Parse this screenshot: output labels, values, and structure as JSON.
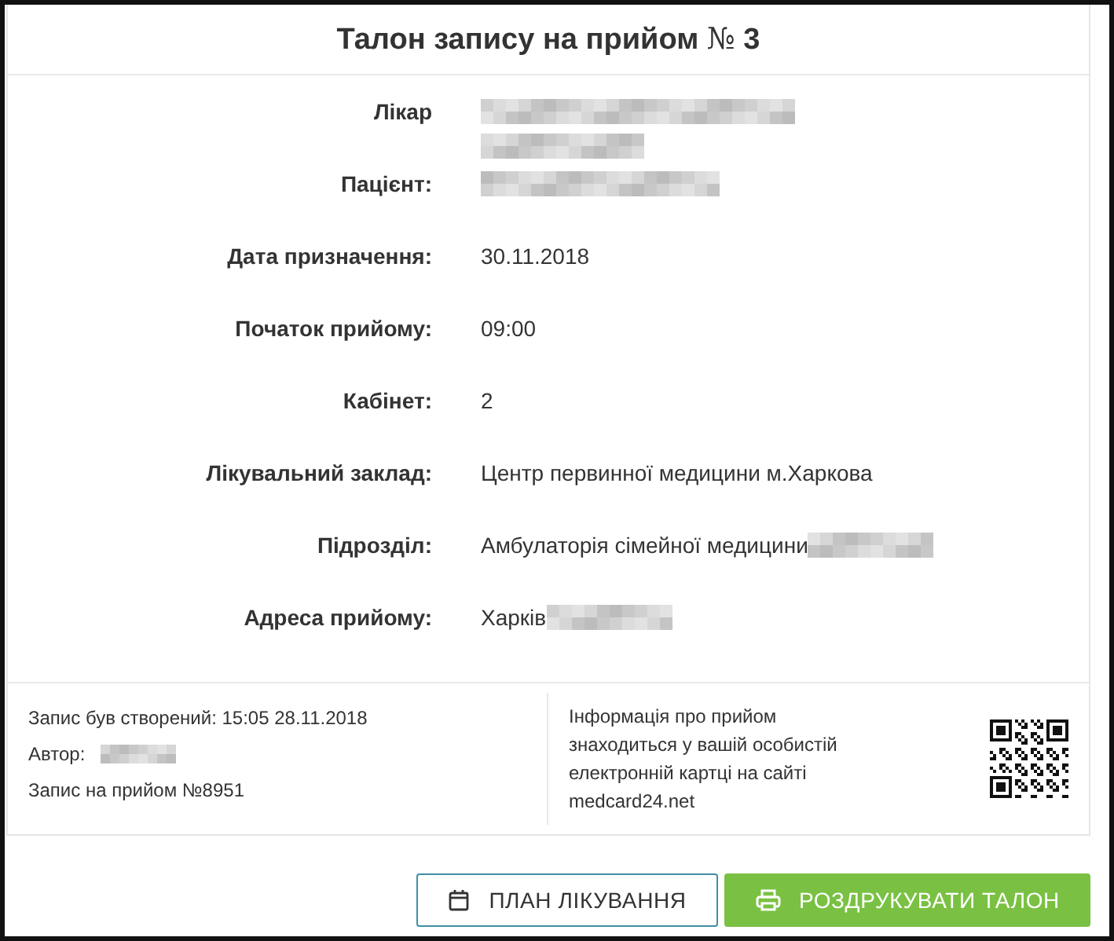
{
  "title": "Талон запису на прийом",
  "number_sign": "№",
  "number": "3",
  "fields": [
    {
      "label": "Лікар",
      "redacted": true
    },
    {
      "label": "Пацієнт:",
      "redacted": true
    },
    {
      "label": "Дата призначення:",
      "value": "30.11.2018"
    },
    {
      "label": "Початок прийому:",
      "value": "09:00"
    },
    {
      "label": "Кабінет:",
      "value": "2"
    },
    {
      "label": "Лікувальний заклад:",
      "value": "Центр первинної медицини м.Харкова"
    },
    {
      "label": "Підрозділ:",
      "value": "Амбулаторія сімейної медицини",
      "redacted": true
    },
    {
      "label": "Адреса прийому:",
      "value": "Харків",
      "redacted": true
    }
  ],
  "footer": {
    "created": "Запис був створений: 15:05 28.11.2018",
    "author_label": "Автор:",
    "author_redacted": true,
    "record": "Запис на прийом №8951",
    "info": "Інформація про прийом знаходиться у вашій особистій електронній картці на сайті medcard24.net"
  },
  "buttons": [
    {
      "label": "ПЛАН ЛІКУВАННЯ",
      "kind": "outline"
    },
    {
      "label": "РОЗДРУКУВАТИ ТАЛОН",
      "kind": "primary"
    }
  ]
}
